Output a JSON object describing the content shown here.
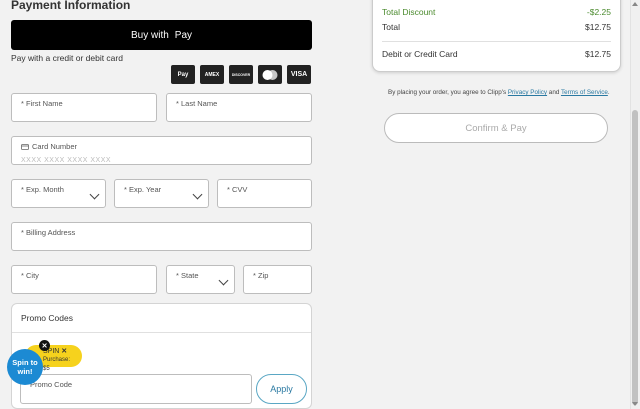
{
  "payment": {
    "title": "Payment Information",
    "applepay_label": "Buy with",
    "applepay_brand": " Pay",
    "subtitle": "Pay with a credit or debit card",
    "cards": [
      "Pay",
      "AMEX",
      "DISCOVER",
      "mastercard",
      "VISA"
    ]
  },
  "form": {
    "first_name": "* First Name",
    "last_name": "* Last Name",
    "card_number_label": "Card Number",
    "card_number_placeholder": "XXXX  XXXX  XXXX  XXXX",
    "exp_month": "* Exp. Month",
    "exp_year": "* Exp. Year",
    "cvv": "* CVV",
    "billing_address": "* Billing Address",
    "city": "* City",
    "state": "* State",
    "zip": "* Zip"
  },
  "promo": {
    "title": "Promo Codes",
    "badge_code": "SPIN",
    "badge_close": "✕",
    "badge_sub": "Purchase: $5",
    "spin_label": "Spin to win!",
    "spin_close": "✕",
    "field_label": "Promo Code",
    "apply_label": "Apply"
  },
  "summary": {
    "rows": [
      {
        "label": "Total Discount",
        "value": "-$2.25",
        "accent": "green"
      },
      {
        "label": "Total",
        "value": "$12.75"
      },
      {
        "label": "Debit or Credit Card",
        "value": "$12.75"
      }
    ],
    "terms_prefix": "By placing your order, you agree to Clipp's ",
    "privacy_link": "Privacy Policy",
    "terms_and": " and ",
    "terms_link": "Terms of Service",
    "terms_suffix": ".",
    "confirm_label": "Confirm & Pay"
  },
  "colors": {
    "accent_blue": "#1c8ad3",
    "green": "#4a8a2d",
    "badge_yellow": "#f6d21d"
  }
}
